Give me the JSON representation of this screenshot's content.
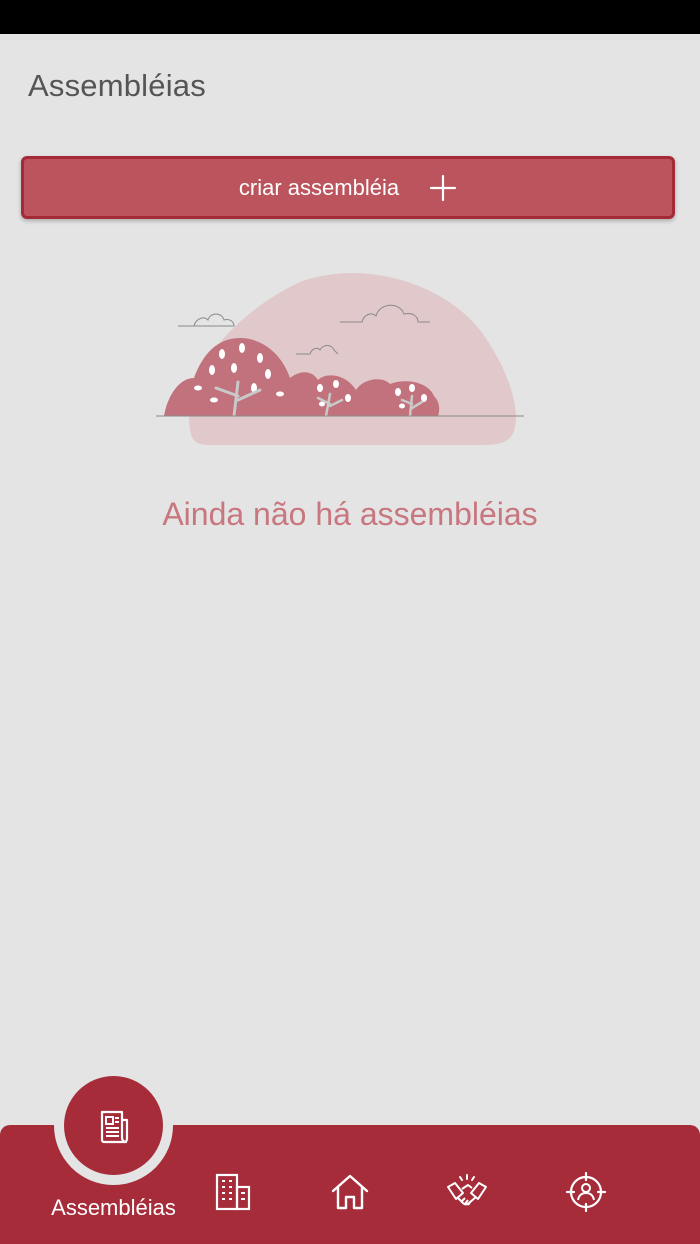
{
  "header": {
    "title": "Assembléias"
  },
  "actions": {
    "create_label": "criar assembléia",
    "create_icon": "plus-icon"
  },
  "empty_state": {
    "message": "Ainda não há assembléias",
    "illustration": "trees-and-clouds"
  },
  "bottom_nav": {
    "active": {
      "label": "Assembléias",
      "icon": "newspaper-icon"
    },
    "items": [
      {
        "icon": "building-icon"
      },
      {
        "icon": "home-icon"
      },
      {
        "icon": "handshake-icon"
      },
      {
        "icon": "person-target-icon"
      }
    ]
  },
  "colors": {
    "accent": "#a62c3a",
    "button": "#bb545d",
    "background": "#e4e4e4",
    "empty_text": "#c8777f",
    "title": "#555555"
  }
}
